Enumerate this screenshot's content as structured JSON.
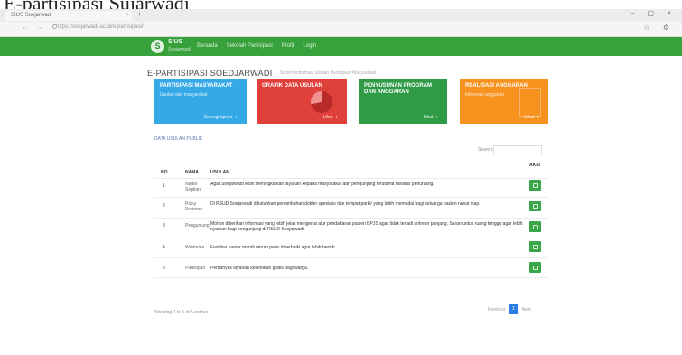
{
  "document_title": "E-partisipasi Sujarwadi",
  "browser": {
    "tab_title": "SIUS Soejarwadi",
    "tab_close": "×",
    "new_tab": "+",
    "window_controls": "– ▢ ×",
    "nav": "← → C",
    "url": "https://soejarwadi.ac.id/e-partisipasi/",
    "addr_icons": "☆ ⚙"
  },
  "header": {
    "logo_text": "S",
    "brand": "SIUS",
    "brand_sub": "Soejarwadi",
    "menu": [
      "Beranda",
      "Sekolah Partisipasi",
      "Profil",
      "Login"
    ]
  },
  "page": {
    "heading": "E-PARTISIPASI SOEDJARWADI",
    "crumb": "Sistem Informasi Usulan Partisipasi Masyarakat"
  },
  "cards": [
    {
      "title": "Partisipasi Masyarakat",
      "sub": "Usulan dari masyarakat",
      "more": "Selengkapnya ➔"
    },
    {
      "title": "Grafik Data Usulan",
      "sub": "",
      "more": "Lihat ➔"
    },
    {
      "title": "Penyusunan Program dan Anggaran",
      "sub": "",
      "more": "Lihat ➔"
    },
    {
      "title": "Realisasi Anggaran",
      "sub": "Informasi anggaran",
      "more": "Lihat ➔"
    }
  ],
  "table": {
    "section_title": "DATA USULAN PUBLIK",
    "search_label": "Search:",
    "columns": {
      "no": "NO",
      "nama": "NAMA",
      "usulan": "USULAN",
      "aksi": "AKSI"
    },
    "rows": [
      {
        "no": "1",
        "nama": "Nadia Septiani",
        "usul": "Agar Soejarwadi lebih meningkatkan layanan kepada masyarakat dan pengunjung terutama fasilitas penunjang."
      },
      {
        "no": "2",
        "nama": "Rizky Pratama",
        "usul": "Di RSUD Soejarwadi dibutuhkan penambahan dokter spesialis dan tempat parkir yang lebih memadai bagi keluarga pasien rawat inap."
      },
      {
        "no": "3",
        "nama": "Pengunjung",
        "usul": "Mohon diberikan informasi yang lebih jelas mengenai alur pendaftaran pasien BPJS agar tidak terjadi antrean panjang. Saran untuk ruang tunggu agar lebih nyaman bagi pengunjung di RSUD Soejarwadi."
      },
      {
        "no": "4",
        "nama": "Wiratama",
        "usul": "Fasilitas kamar mandi umum perlu diperbaiki agar lebih bersih."
      },
      {
        "no": "5",
        "nama": "Partisipan",
        "usul": "Perbanyak layanan kesehatan gratis bagi warga."
      }
    ],
    "footer_info": "Showing 1 to 5 of 5 entries",
    "pager": {
      "prev": "Previous",
      "page": "1",
      "next": "Next"
    }
  }
}
